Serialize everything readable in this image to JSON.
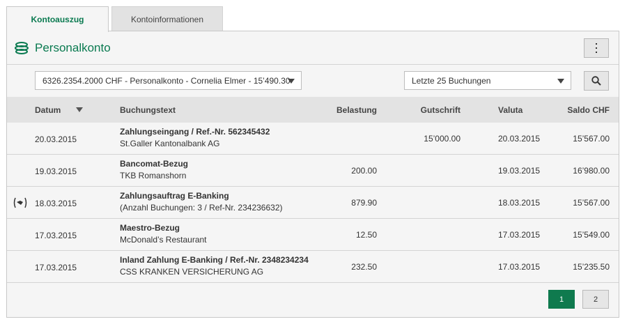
{
  "tabs": [
    {
      "label": "Kontoauszug",
      "active": true
    },
    {
      "label": "Kontoinformationen",
      "active": false
    }
  ],
  "header": {
    "title": "Personalkonto",
    "title_icon": "coins-icon",
    "menu_icon": "kebab-menu-icon"
  },
  "filters": {
    "account": "6326.2354.2000 CHF - Personalkonto - Cornelia Elmer - 15’490.30",
    "period": "Letzte 25 Buchungen",
    "search_icon": "search-icon"
  },
  "columns": {
    "datum": "Datum",
    "buchungstext": "Buchungstext",
    "belastung": "Belastung",
    "gutschrift": "Gutschrift",
    "valuta": "Valuta",
    "saldo": "Saldo CHF"
  },
  "rows": [
    {
      "date": "20.03.2015",
      "text1": "Zahlungseingang / Ref.-Nr. 562345432",
      "text2": "St.Galler Kantonalbank AG",
      "belastung": "",
      "gutschrift": "15’000.00",
      "valuta": "20.03.2015",
      "saldo": "15’567.00"
    },
    {
      "date": "19.03.2015",
      "text1": "Bancomat-Bezug",
      "text2": "TKB Romanshorn",
      "belastung": "200.00",
      "gutschrift": "",
      "valuta": "19.03.2015",
      "saldo": "16’980.00"
    },
    {
      "date": "18.03.2015",
      "text1": "Zahlungsauftrag E-Banking",
      "text2": "(Anzahl Buchungen: 3 / Ref-Nr. 234236632)",
      "belastung": "879.90",
      "gutschrift": "",
      "valuta": "18.03.2015",
      "saldo": "15’567.00",
      "icon": "payment-order-icon"
    },
    {
      "date": "17.03.2015",
      "text1": "Maestro-Bezug",
      "text2": "McDonald’s Restaurant",
      "belastung": "12.50",
      "gutschrift": "",
      "valuta": "17.03.2015",
      "saldo": "15’549.00"
    },
    {
      "date": "17.03.2015",
      "text1": "Inland Zahlung E-Banking / Ref.-Nr. 2348234234",
      "text2": "CSS KRANKEN VERSICHERUNG AG",
      "belastung": "232.50",
      "gutschrift": "",
      "valuta": "17.03.2015",
      "saldo": "15’235.50"
    }
  ],
  "pagination": {
    "pages": [
      "1",
      "2"
    ],
    "current": "1"
  },
  "colors": {
    "accent": "#0a7a50",
    "page_active": "#0f7a4e"
  }
}
